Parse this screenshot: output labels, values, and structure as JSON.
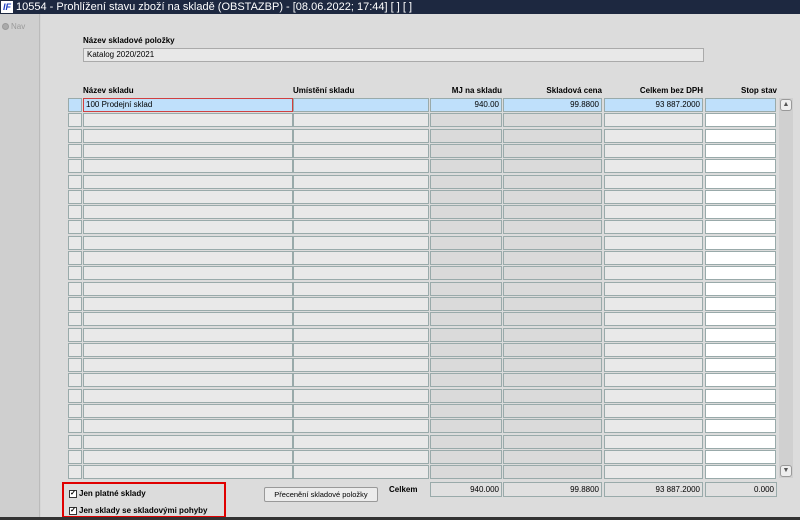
{
  "window": {
    "title": "10554 - Prohlížení stavu zboží na skladě (OBSTAZBP) - [08.06.2022; 17:44]  [ ]  [ ]",
    "logo": "IF"
  },
  "nav": {
    "label": "Nav"
  },
  "item": {
    "label": "Název skladové položky",
    "value": "Katalog 2020/2021"
  },
  "table": {
    "headers": [
      "Název skladu",
      "Umístění skladu",
      "MJ na skladu",
      "Skladová cena",
      "Celkem bez DPH",
      "Stop stav"
    ],
    "rows": [
      {
        "name": "100 Prodejní sklad",
        "location": "",
        "qty": "940.00",
        "price": "99.8800",
        "total": "93 887.2000",
        "stop": ""
      }
    ],
    "empty_rows": 24
  },
  "footer": {
    "total_label": "Celkem",
    "qty": "940.000",
    "price": "99.8800",
    "total": "93 887.2000",
    "stop": "0.000",
    "revalue_button": "Přecenění skladové položky",
    "check1": {
      "label": "Jen platné sklady",
      "checked": true
    },
    "check2": {
      "label": "Jen sklady se skladovými pohyby",
      "checked": true
    }
  }
}
